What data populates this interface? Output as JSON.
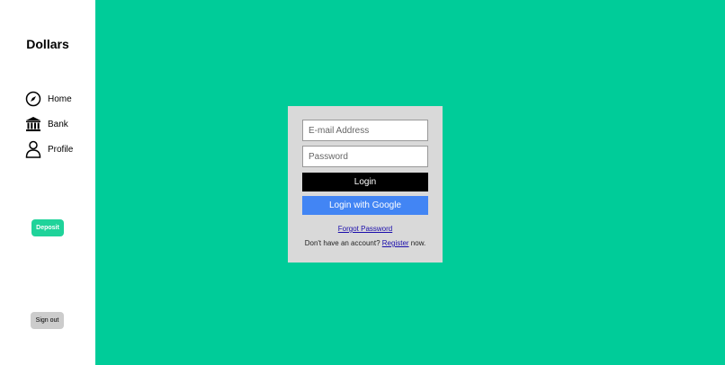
{
  "sidebar": {
    "brand": "Dollars",
    "items": [
      {
        "label": "Home",
        "icon": "compass-icon"
      },
      {
        "label": "Bank",
        "icon": "bank-icon"
      },
      {
        "label": "Profile",
        "icon": "user-icon"
      }
    ],
    "deposit_label": "Deposit",
    "signout_label": "Sign out"
  },
  "login": {
    "email_placeholder": "E-mail Address",
    "password_placeholder": "Password",
    "login_label": "Login",
    "google_label": "Login with Google",
    "forgot_label": "Forgot Password",
    "register_prefix": "Don't have an account?",
    "register_link": "Register",
    "register_suffix": "now."
  },
  "colors": {
    "background": "#00cc99",
    "deposit": "#1fd39a",
    "google": "#4285f4",
    "panel": "#d9d9d9"
  }
}
